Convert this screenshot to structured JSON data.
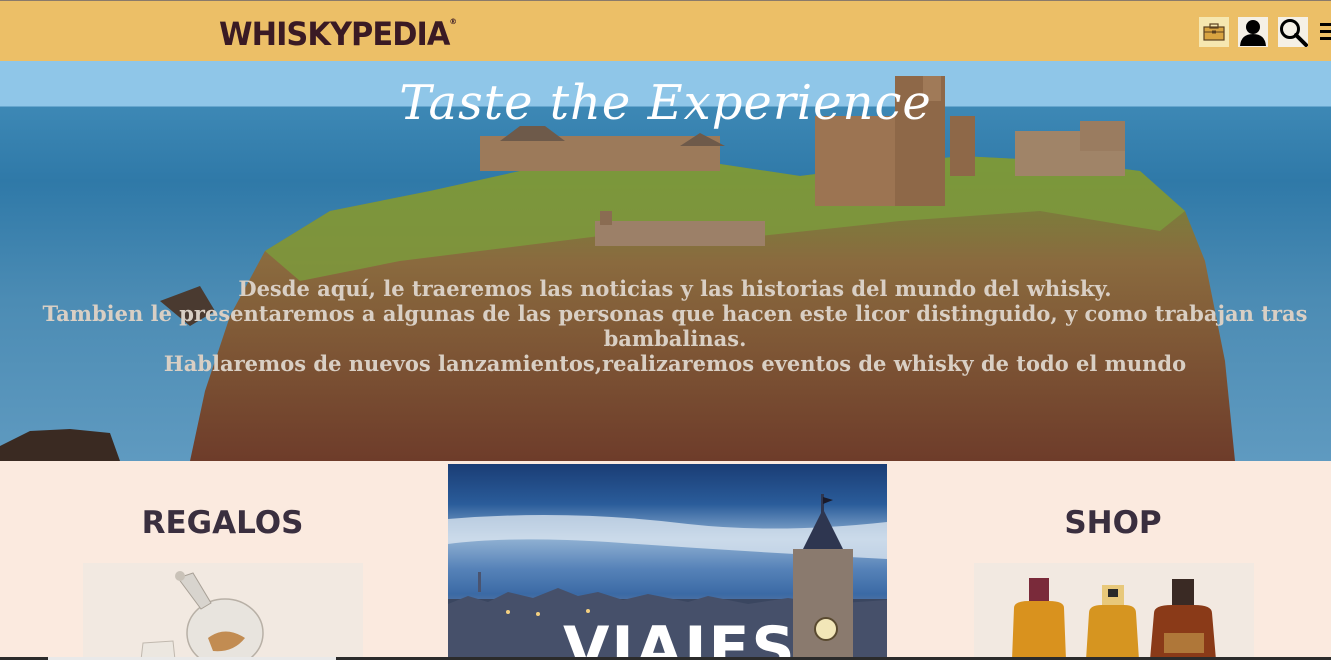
{
  "header": {
    "logo_text": "WHISKYPEDIA",
    "logo_mark": "®",
    "icons": [
      "briefcase-icon",
      "user-icon",
      "search-icon",
      "menu-icon"
    ],
    "colors": {
      "bar": "#ecbf67",
      "logo": "#3a1a24"
    }
  },
  "hero": {
    "title": "Taste the Experience",
    "lines": [
      "Desde aquí, le traeremos las noticias y las historias del mundo del whisky.",
      "Tambien le presentaremos a algunas de las personas que hacen este licor distinguido, y como trabajan tras bambalinas.",
      "Hablaremos de nuevos lanzamientos,realizaremos eventos de whisky de todo el mundo"
    ]
  },
  "sections": {
    "regalos": {
      "title": "REGALOS"
    },
    "viajes": {
      "label": "VIAJES"
    },
    "shop": {
      "title": "SHOP"
    }
  },
  "colors": {
    "background": "#fbeadf",
    "section_title": "#3a2f3f"
  }
}
